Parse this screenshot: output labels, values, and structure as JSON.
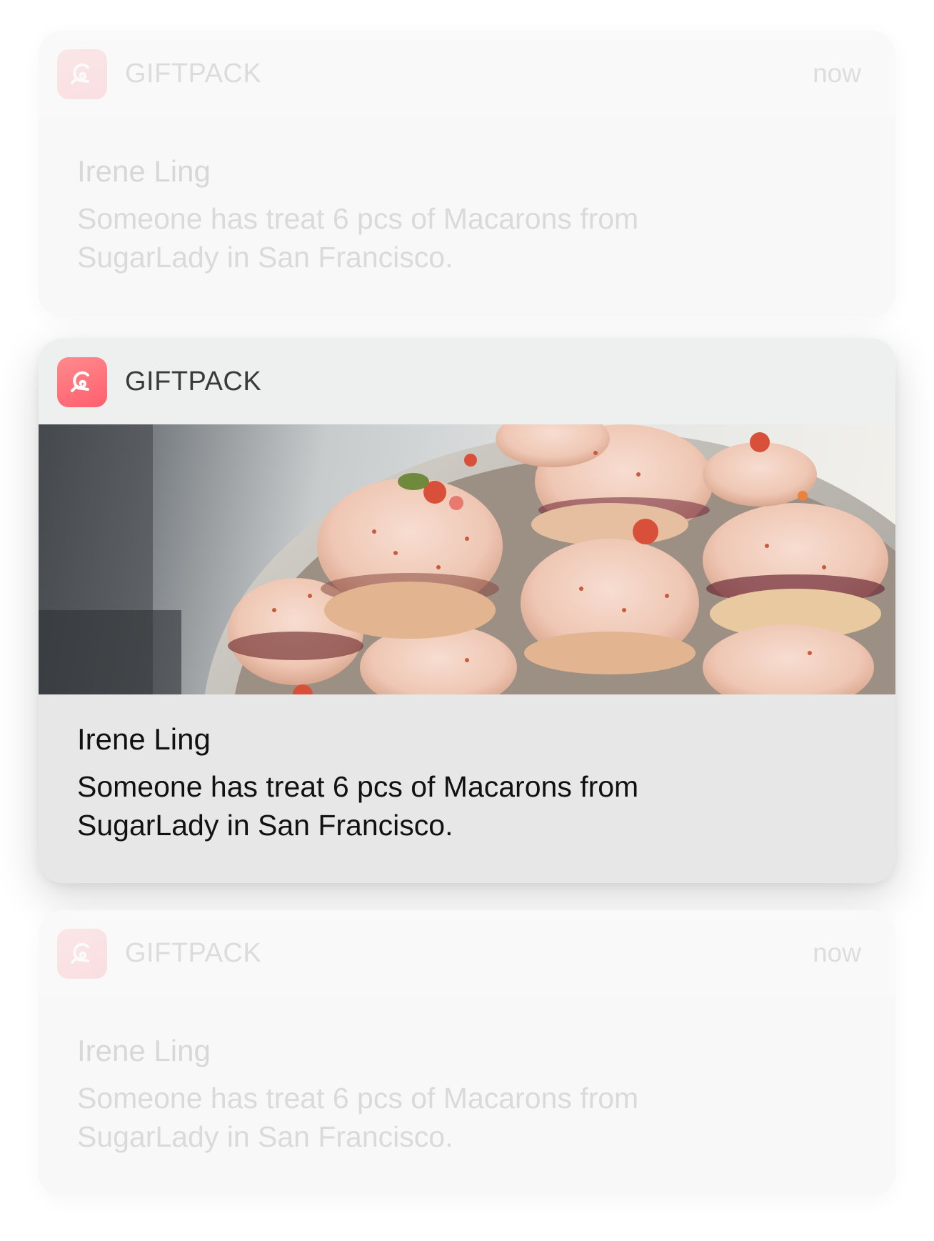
{
  "notifications": [
    {
      "app_name": "GIFTPACK",
      "time": "now",
      "sender": "Irene Ling",
      "message": "Someone has treat 6 pcs of Macarons from SugarLady in San Francisco."
    },
    {
      "app_name": "GIFTPACK",
      "sender": "Irene Ling",
      "message": "Someone has treat 6 pcs of Macarons from SugarLady in San Francisco.",
      "image": "macarons-photo"
    },
    {
      "app_name": "GIFTPACK",
      "time": "now",
      "sender": "Irene Ling",
      "message": "Someone has treat 6 pcs of Macarons from SugarLady in San Francisco."
    }
  ],
  "icons": {
    "app_icon": "giftpack-logo-icon"
  },
  "colors": {
    "brand": "#ff6b74",
    "main_card_bg": "#e7e7e7",
    "main_header_bg": "#eef0ef"
  }
}
